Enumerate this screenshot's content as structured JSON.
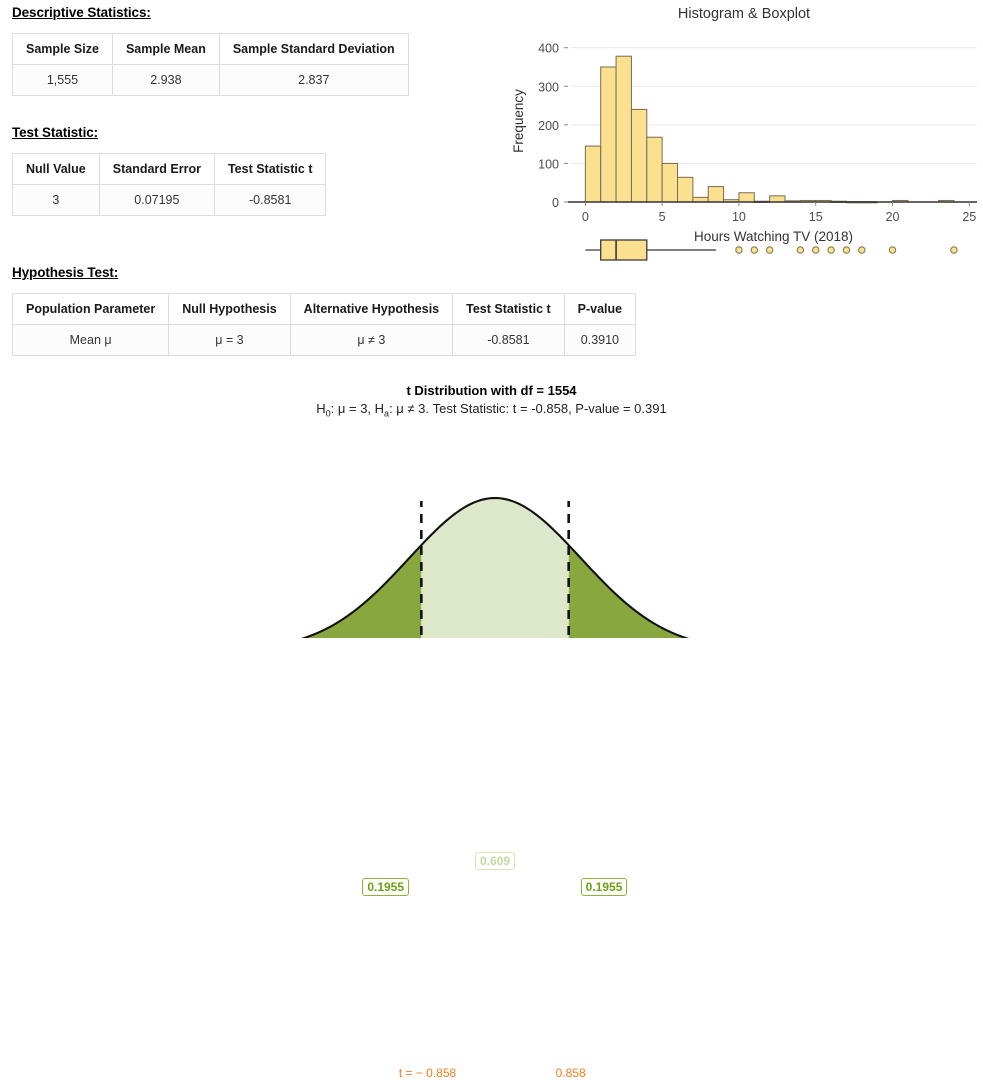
{
  "sections": {
    "descriptive": {
      "heading": "Descriptive Statistics:",
      "headers": [
        "Sample Size",
        "Sample Mean",
        "Sample Standard Deviation"
      ],
      "row": [
        "1,555",
        "2.938",
        "2.837"
      ]
    },
    "test_statistic": {
      "heading": "Test Statistic:",
      "headers": [
        "Null Value",
        "Standard Error",
        "Test Statistic t"
      ],
      "row": [
        "3",
        "0.07195",
        "-0.8581"
      ]
    },
    "hypothesis_test": {
      "heading": "Hypothesis Test:",
      "headers": [
        "Population Parameter",
        "Null Hypothesis",
        "Alternative Hypothesis",
        "Test Statistic t",
        "P-value"
      ],
      "row": [
        "Mean μ",
        "μ = 3",
        "μ ≠ 3",
        "-0.8581",
        "0.3910"
      ]
    }
  },
  "t_plot": {
    "title": "t Distribution with df = 1554",
    "subtitle_parts": {
      "h0_prefix": "H",
      "h0_sub": "0",
      "h0_text": ":  μ  =  3, ",
      "ha_prefix": "H",
      "ha_sub": "a",
      "ha_text": ":  μ  ≠  3. Test Statistic: t  =  -0.858, P-value  =  0.391"
    },
    "left_tail_label": "0.1955",
    "center_label": "0.609",
    "right_tail_label": "0.1955",
    "left_marker_label": "t = − 0.858",
    "right_marker_label": "0.858",
    "colors": {
      "tail_fill": "#88a83f",
      "center_fill": "#dde8cb",
      "curve": "#111111",
      "marker": "#f07c1a",
      "label_green": "#6f9f12"
    }
  },
  "chart_data": [
    {
      "type": "bar",
      "name": "histogram",
      "title": "Histogram & Boxplot",
      "xlabel": "Hours Watching TV (2018)",
      "ylabel": "Frequency",
      "xlim": [
        -1,
        25.5
      ],
      "ylim": [
        0,
        420
      ],
      "xticks": [
        0,
        5,
        10,
        15,
        20,
        25
      ],
      "yticks": [
        0,
        100,
        200,
        300,
        400
      ],
      "grid": "horizontal",
      "bin_width": 1,
      "bin_starts": [
        0,
        1,
        2,
        3,
        4,
        5,
        6,
        7,
        8,
        9,
        10,
        11,
        12,
        13,
        14,
        15,
        16,
        17,
        18,
        19,
        20,
        23
      ],
      "values": [
        145,
        350,
        378,
        240,
        168,
        100,
        64,
        12,
        40,
        6,
        24,
        2,
        16,
        3,
        4,
        4,
        2,
        1,
        1,
        0,
        4,
        4
      ],
      "bar_fill": "#fbe08f",
      "bar_stroke": "#7a6a52"
    },
    {
      "type": "boxplot",
      "name": "boxplot",
      "xlim": [
        -1,
        25.5
      ],
      "min": 0,
      "q1": 1,
      "median": 2,
      "q3": 4,
      "upper_whisker": 8.5,
      "outliers": [
        10,
        11,
        12,
        14,
        15,
        16,
        17,
        18,
        20,
        24
      ],
      "box_fill": "#fbe08f",
      "box_stroke": "#3a3a3a",
      "outlier_fill": "#fbe08f",
      "outlier_stroke": "#8a7a52"
    },
    {
      "type": "line",
      "name": "t-distribution",
      "distribution": "t",
      "df": 1554,
      "xlim": [
        -4.6,
        4.6
      ],
      "xticks": [
        -4,
        -3,
        -2,
        -1,
        0,
        1,
        2,
        3,
        4
      ],
      "critical_values": [
        -0.858,
        0.858
      ],
      "tail_area_left": 0.1955,
      "tail_area_right": 0.1955,
      "center_area": 0.609,
      "test_statistic": -0.858
    }
  ]
}
